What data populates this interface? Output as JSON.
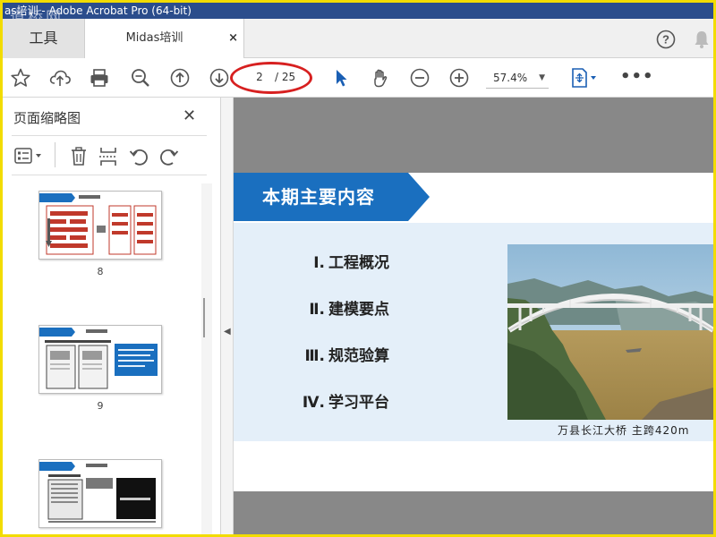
{
  "window": {
    "title": "as培训 - Adobe Acrobat Pro (64-bit)",
    "watermark": "道桥网"
  },
  "tabs": {
    "tools_label": "工具",
    "doc_label": "Midas培训",
    "doc_close": "×"
  },
  "toolbar": {
    "page_current": "2",
    "page_total": "/ 25",
    "zoom": "57.4%",
    "zoom_arrow": "▼",
    "more": "•••"
  },
  "thumb_panel": {
    "title": "页面缩略图",
    "close": "✕",
    "thumbnails": [
      {
        "page": "8"
      },
      {
        "page": "9"
      },
      {
        "page": ""
      }
    ]
  },
  "slide": {
    "header": "本期主要内容",
    "toc": [
      {
        "num": "Ⅰ.",
        "text": "工程概况"
      },
      {
        "num": "Ⅱ.",
        "text": "建模要点"
      },
      {
        "num": "Ⅲ.",
        "text": "规范验算"
      },
      {
        "num": "Ⅳ.",
        "text": "学习平台"
      }
    ],
    "caption": "万县长江大桥 主跨420m"
  },
  "colors": {
    "titlebar": "#2b4d8c",
    "frame": "#f2dc00",
    "slide_header": "#1a6fbf",
    "slide_band": "#e4eff9",
    "page_highlight": "#d72020",
    "doc_background": "#888888"
  }
}
